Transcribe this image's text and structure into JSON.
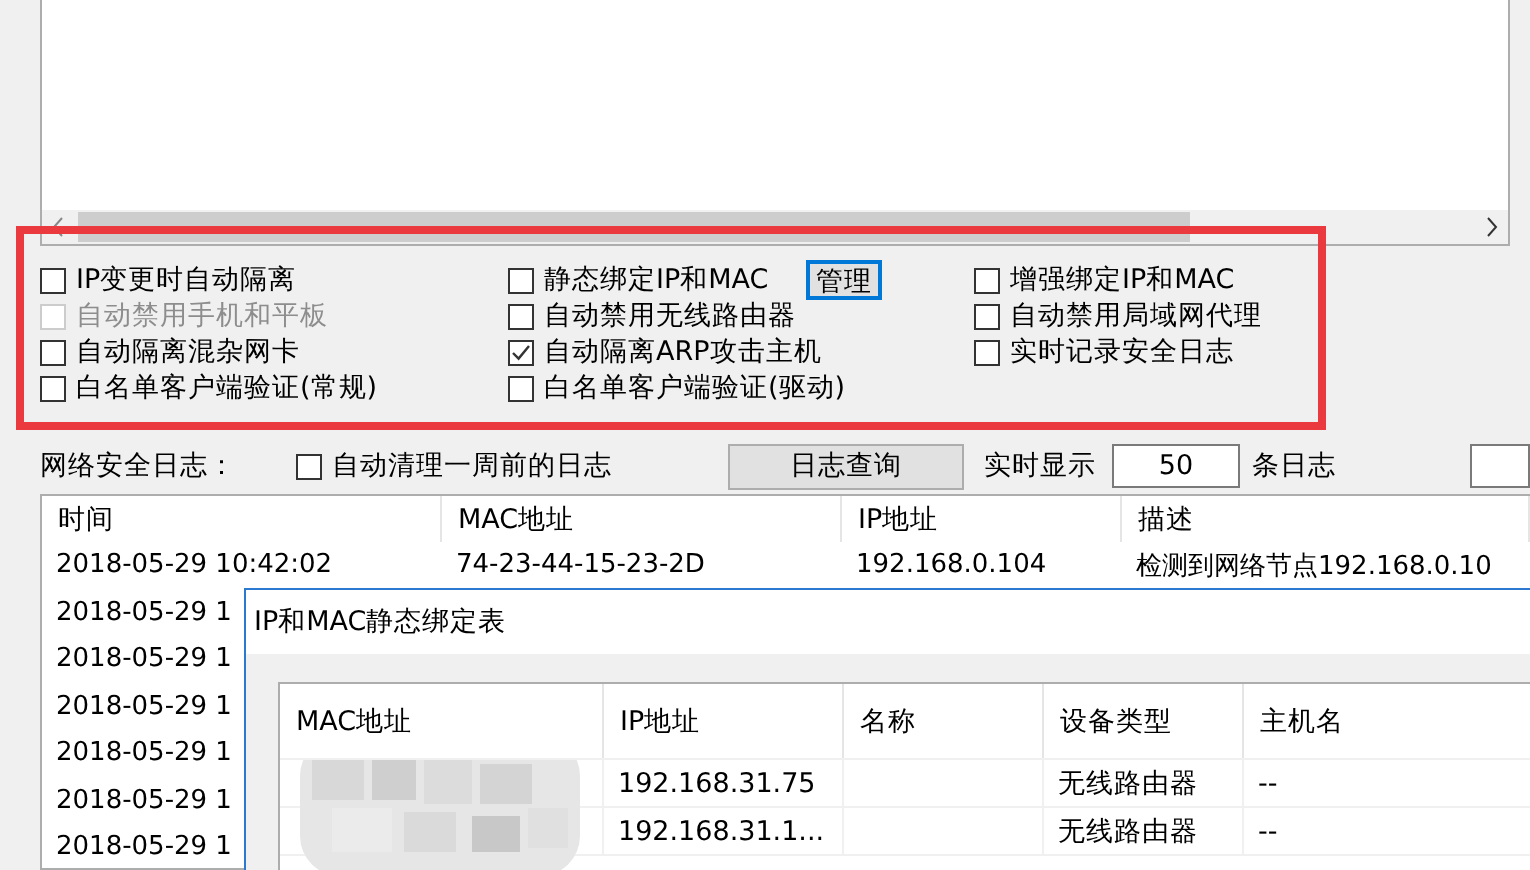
{
  "options": [
    {
      "label": "IP变更时自动隔离",
      "checked": false,
      "disabled": false
    },
    {
      "label": "静态绑定IP和MAC",
      "checked": false,
      "disabled": false,
      "action": "管理"
    },
    {
      "label": "增强绑定IP和MAC",
      "checked": false,
      "disabled": false
    },
    {
      "label": "自动禁用手机和平板",
      "checked": false,
      "disabled": true
    },
    {
      "label": "自动禁用无线路由器",
      "checked": false,
      "disabled": false
    },
    {
      "label": "自动禁用局域网代理",
      "checked": false,
      "disabled": false
    },
    {
      "label": "自动隔离混杂网卡",
      "checked": false,
      "disabled": false
    },
    {
      "label": "自动隔离ARP攻击主机",
      "checked": true,
      "disabled": false
    },
    {
      "label": "实时记录安全日志",
      "checked": false,
      "disabled": false
    },
    {
      "label": "白名单客户端验证(常规)",
      "checked": false,
      "disabled": false
    },
    {
      "label": "白名单客户端验证(驱动)",
      "checked": false,
      "disabled": false
    }
  ],
  "log_bar": {
    "label": "网络安全日志：",
    "auto_clean": {
      "label": "自动清理一周前的日志",
      "checked": false
    },
    "query_button": "日志查询",
    "realtime_label": "实时显示",
    "count": "50",
    "count_unit": "条日志"
  },
  "log_table": {
    "columns": [
      "时间",
      "MAC地址",
      "IP地址",
      "描述"
    ],
    "rows": [
      [
        "2018-05-29 10:42:02",
        "74-23-44-15-23-2D",
        "192.168.0.104",
        "检测到网络节点192.168.0.10"
      ],
      [
        "2018-05-29 1"
      ],
      [
        "2018-05-29 1"
      ],
      [
        "2018-05-29 1"
      ],
      [
        "2018-05-29 1"
      ],
      [
        "2018-05-29 1"
      ],
      [
        "2018-05-29 1"
      ]
    ]
  },
  "dialog": {
    "title": "IP和MAC静态绑定表",
    "columns": [
      "MAC地址",
      "IP地址",
      "名称",
      "设备类型",
      "主机名"
    ],
    "rows": [
      [
        "",
        "192.168.31.75",
        "",
        "无线路由器",
        "--"
      ],
      [
        "",
        "192.168.31.1...",
        "",
        "无线路由器",
        "--"
      ]
    ]
  }
}
